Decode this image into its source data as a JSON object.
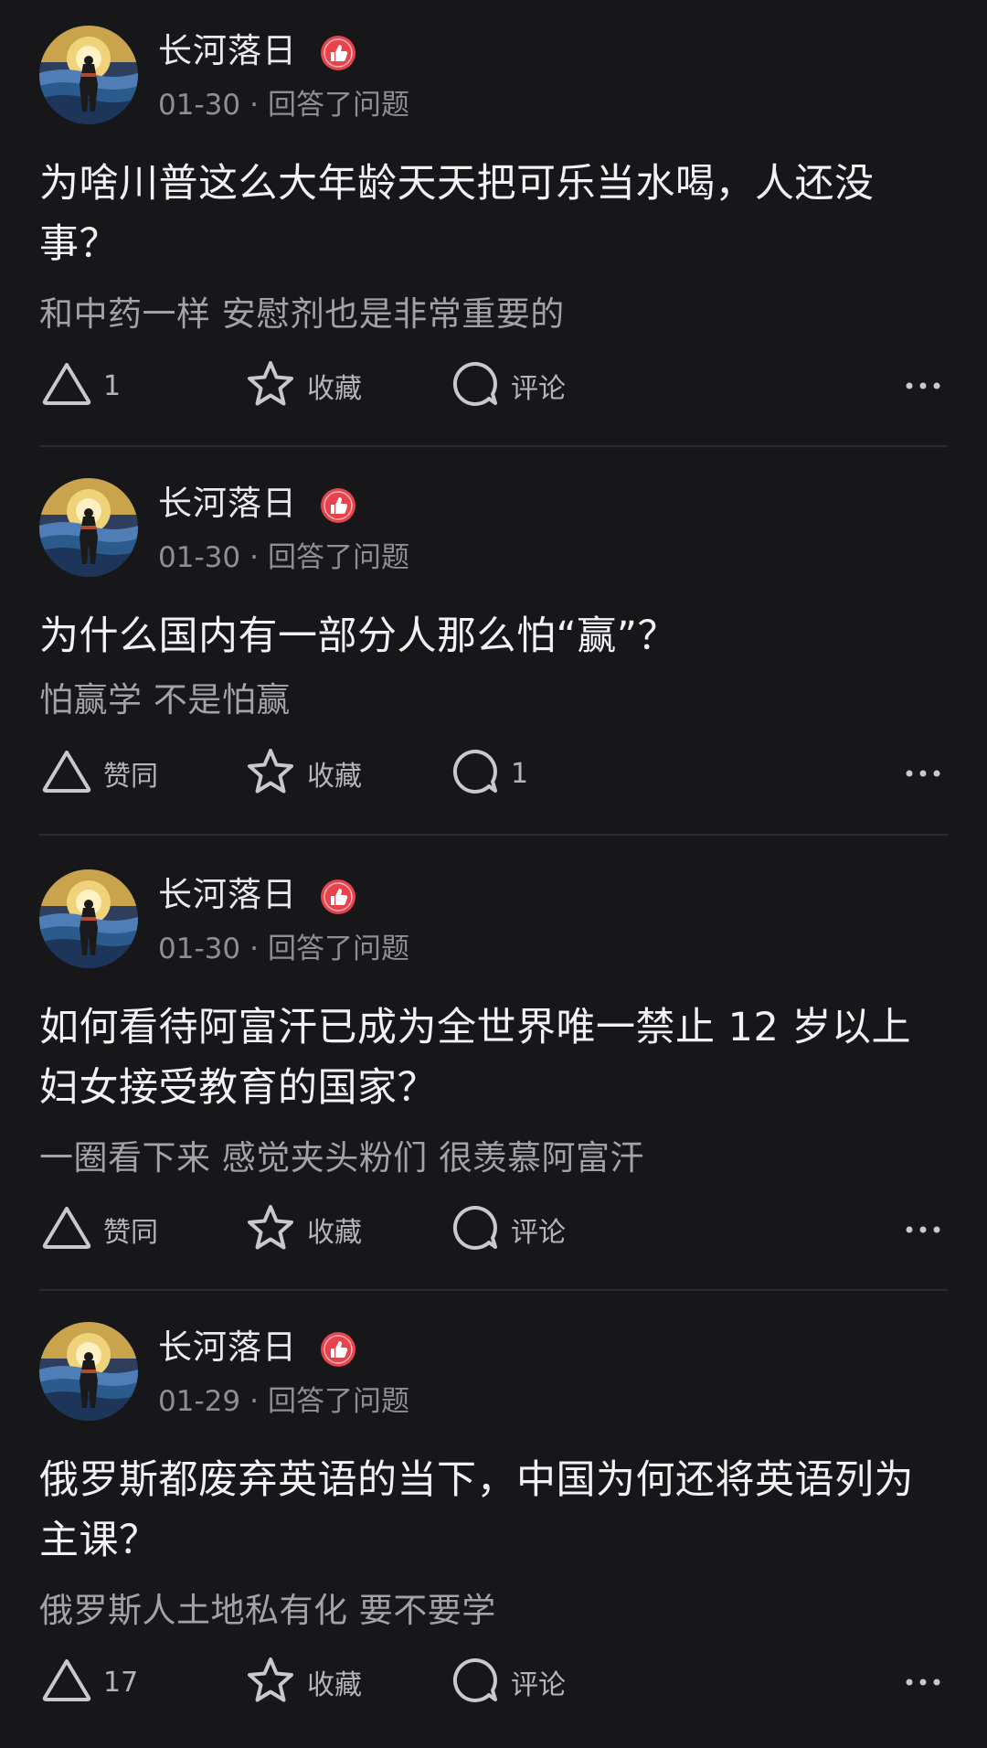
{
  "colors": {
    "background": "#17171a",
    "badge": "#e8434d"
  },
  "icons": {
    "upvote": "triangle-up-icon",
    "favorite": "star-icon",
    "comment": "speech-bubble-icon",
    "more": "more-horizontal-icon",
    "badge": "thumbs-up-badge-icon"
  },
  "feed": [
    {
      "author": "长河落日",
      "date": "01-30",
      "sep": "·",
      "action_text": "回答了问题",
      "title": "为啥川普这么大年龄天天把可乐当水喝，人还没事？",
      "excerpt": "和中药一样 安慰剂也是非常重要的",
      "upvote_label": "1",
      "favorite_label": "收藏",
      "comment_label": "评论"
    },
    {
      "author": "长河落日",
      "date": "01-30",
      "sep": "·",
      "action_text": "回答了问题",
      "title": "为什么国内有一部分人那么怕“赢”？",
      "excerpt": "怕赢学 不是怕赢",
      "upvote_label": "赞同",
      "favorite_label": "收藏",
      "comment_label": "1"
    },
    {
      "author": "长河落日",
      "date": "01-30",
      "sep": "·",
      "action_text": "回答了问题",
      "title": "如何看待阿富汗已成为全世界唯一禁止 12 岁以上妇女接受教育的国家？",
      "excerpt": "一圈看下来 感觉夹头粉们 很羡慕阿富汗",
      "upvote_label": "赞同",
      "favorite_label": "收藏",
      "comment_label": "评论"
    },
    {
      "author": "长河落日",
      "date": "01-29",
      "sep": "·",
      "action_text": "回答了问题",
      "title": "俄罗斯都废弃英语的当下，中国为何还将英语列为主课？",
      "excerpt": "俄罗斯人土地私有化 要不要学",
      "upvote_label": "17",
      "favorite_label": "收藏",
      "comment_label": "评论"
    }
  ]
}
